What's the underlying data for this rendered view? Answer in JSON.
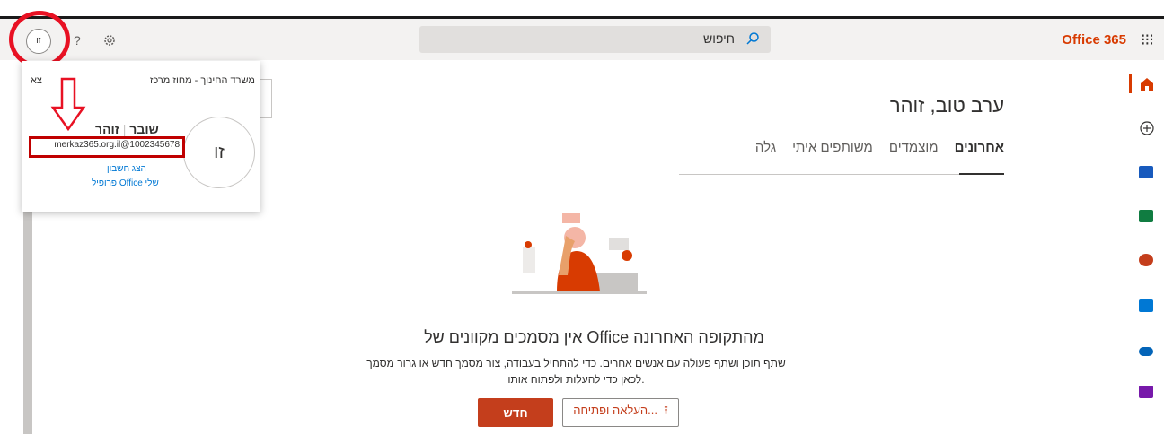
{
  "topbar": {
    "brand": "Office 365",
    "search_label": "חיפוש",
    "avatar_initials": "זו"
  },
  "main": {
    "greeting": "ערב טוב, זוהר",
    "tabs": [
      "אחרונים",
      "מוצמדים",
      "משותפים איתי",
      "גלה"
    ],
    "empty_title": "אין מסמכים מקוונים של Office מהתקופה האחרונה",
    "empty_desc_line1": "שתף תוכן ושתף פעולה עם אנשים אחרים. כדי להתחיל בעבודה, צור מסמך חדש או גרור מסמך",
    "empty_desc_line2": "לכאן כדי להעלות ולפתוח אותו.",
    "new_button": "חדש",
    "upload_button": "העלאה ופתיחה..."
  },
  "account_card": {
    "org": "משרד החינוך - מחוז מרכז",
    "sign_out": "צא",
    "avatar_initials": "זו",
    "first_name": "זוהר",
    "last_name": "שובר",
    "email": "merkaz365.org.il@1002345678",
    "view_account": "הצג חשבון",
    "my_profile": "פרופיל Office שלי"
  },
  "rail_icons": [
    "home-icon",
    "add-icon",
    "word-icon",
    "excel-icon",
    "powerpoint-icon",
    "outlook-icon",
    "onedrive-icon",
    "onenote-icon"
  ],
  "colors": {
    "accent": "#d83b01",
    "button": "#c43e1c",
    "annotation": "#e81123"
  }
}
